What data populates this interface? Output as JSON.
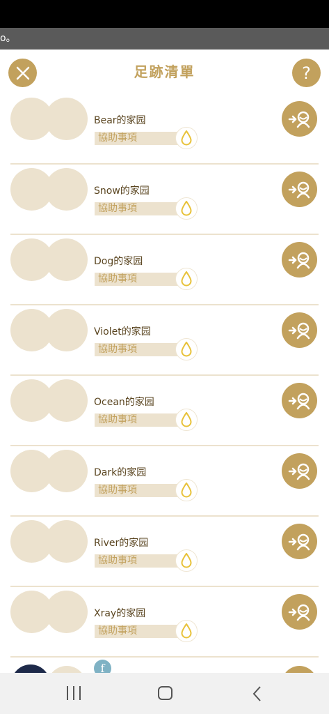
{
  "notice": {
    "text": "o。"
  },
  "header": {
    "title": "足跡清單",
    "help_label": "?"
  },
  "tag_label": "協助事項",
  "rows": [
    {
      "name": "Bear的家园"
    },
    {
      "name": "Snow的家园"
    },
    {
      "name": "Dog的家园"
    },
    {
      "name": "Violet的家园"
    },
    {
      "name": "Ocean的家园"
    },
    {
      "name": "Dark的家园"
    },
    {
      "name": "River的家园"
    },
    {
      "name": "Xray的家园"
    }
  ],
  "partial_row": {
    "badge": "f"
  },
  "colors": {
    "accent": "#c2a15d",
    "muted": "#ece2ce",
    "name_text": "#5a4520"
  },
  "icons": {
    "close": "close-x-icon",
    "help": "question-icon",
    "drop": "drop-icon",
    "visit": "visit-footprint-icon"
  }
}
